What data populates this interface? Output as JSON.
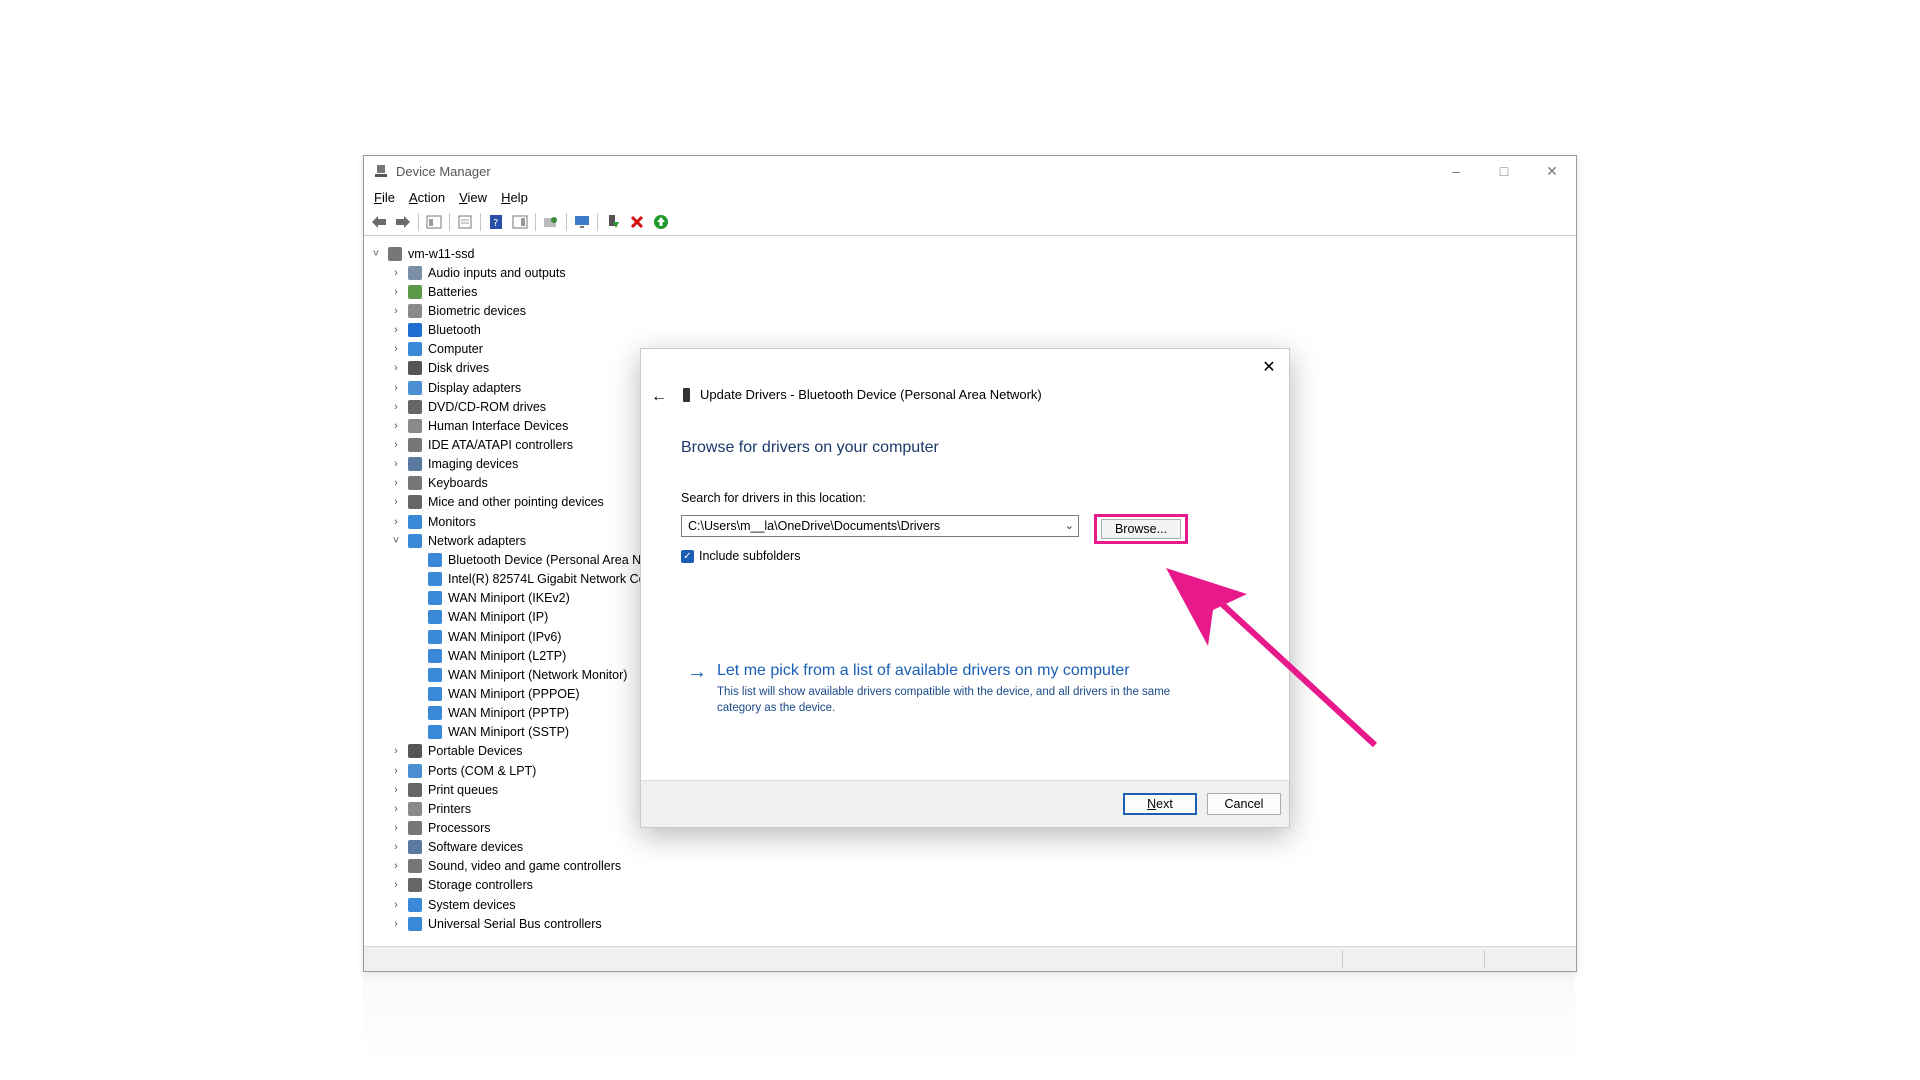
{
  "window": {
    "title": "Device Manager",
    "menu": [
      "File",
      "Action",
      "View",
      "Help"
    ]
  },
  "tree": {
    "root": "vm-w11-ssd",
    "categories": [
      "Audio inputs and outputs",
      "Batteries",
      "Biometric devices",
      "Bluetooth",
      "Computer",
      "Disk drives",
      "Display adapters",
      "DVD/CD-ROM drives",
      "Human Interface Devices",
      "IDE ATA/ATAPI controllers",
      "Imaging devices",
      "Keyboards",
      "Mice and other pointing devices",
      "Monitors",
      "Network adapters"
    ],
    "network_children": [
      "Bluetooth Device (Personal Area N",
      "Intel(R) 82574L Gigabit Network Cc",
      "WAN Miniport (IKEv2)",
      "WAN Miniport (IP)",
      "WAN Miniport (IPv6)",
      "WAN Miniport (L2TP)",
      "WAN Miniport (Network Monitor)",
      "WAN Miniport (PPPOE)",
      "WAN Miniport (PPTP)",
      "WAN Miniport (SSTP)"
    ],
    "categories_after": [
      "Portable Devices",
      "Ports (COM & LPT)",
      "Print queues",
      "Printers",
      "Processors",
      "Software devices",
      "Sound, video and game controllers",
      "Storage controllers",
      "System devices",
      "Universal Serial Bus controllers"
    ]
  },
  "dialog": {
    "title": "Update Drivers - Bluetooth Device (Personal Area Network)",
    "heading": "Browse for drivers on your computer",
    "search_label": "Search for drivers in this location:",
    "path_value": "C:\\Users\\m__la\\OneDrive\\Documents\\Drivers",
    "browse_label": "Browse...",
    "include_subfolders_label": "Include subfolders",
    "include_subfolders_checked": true,
    "pick_link": "Let me pick from a list of available drivers on my computer",
    "pick_desc": "This list will show available drivers compatible with the device, and all drivers in the same category as the device.",
    "next_label": "Next",
    "cancel_label": "Cancel"
  },
  "colors": {
    "highlight": "#e8198b",
    "link": "#1a5fb4",
    "accent": "#1a5fb4"
  },
  "icons": {
    "toolbar": [
      "back-arrow-icon",
      "forward-arrow-icon",
      "properties-icon",
      "help-icon",
      "scan-hardware-icon",
      "monitor-icon",
      "add-driver-icon",
      "uninstall-icon",
      "enable-device-icon"
    ]
  }
}
